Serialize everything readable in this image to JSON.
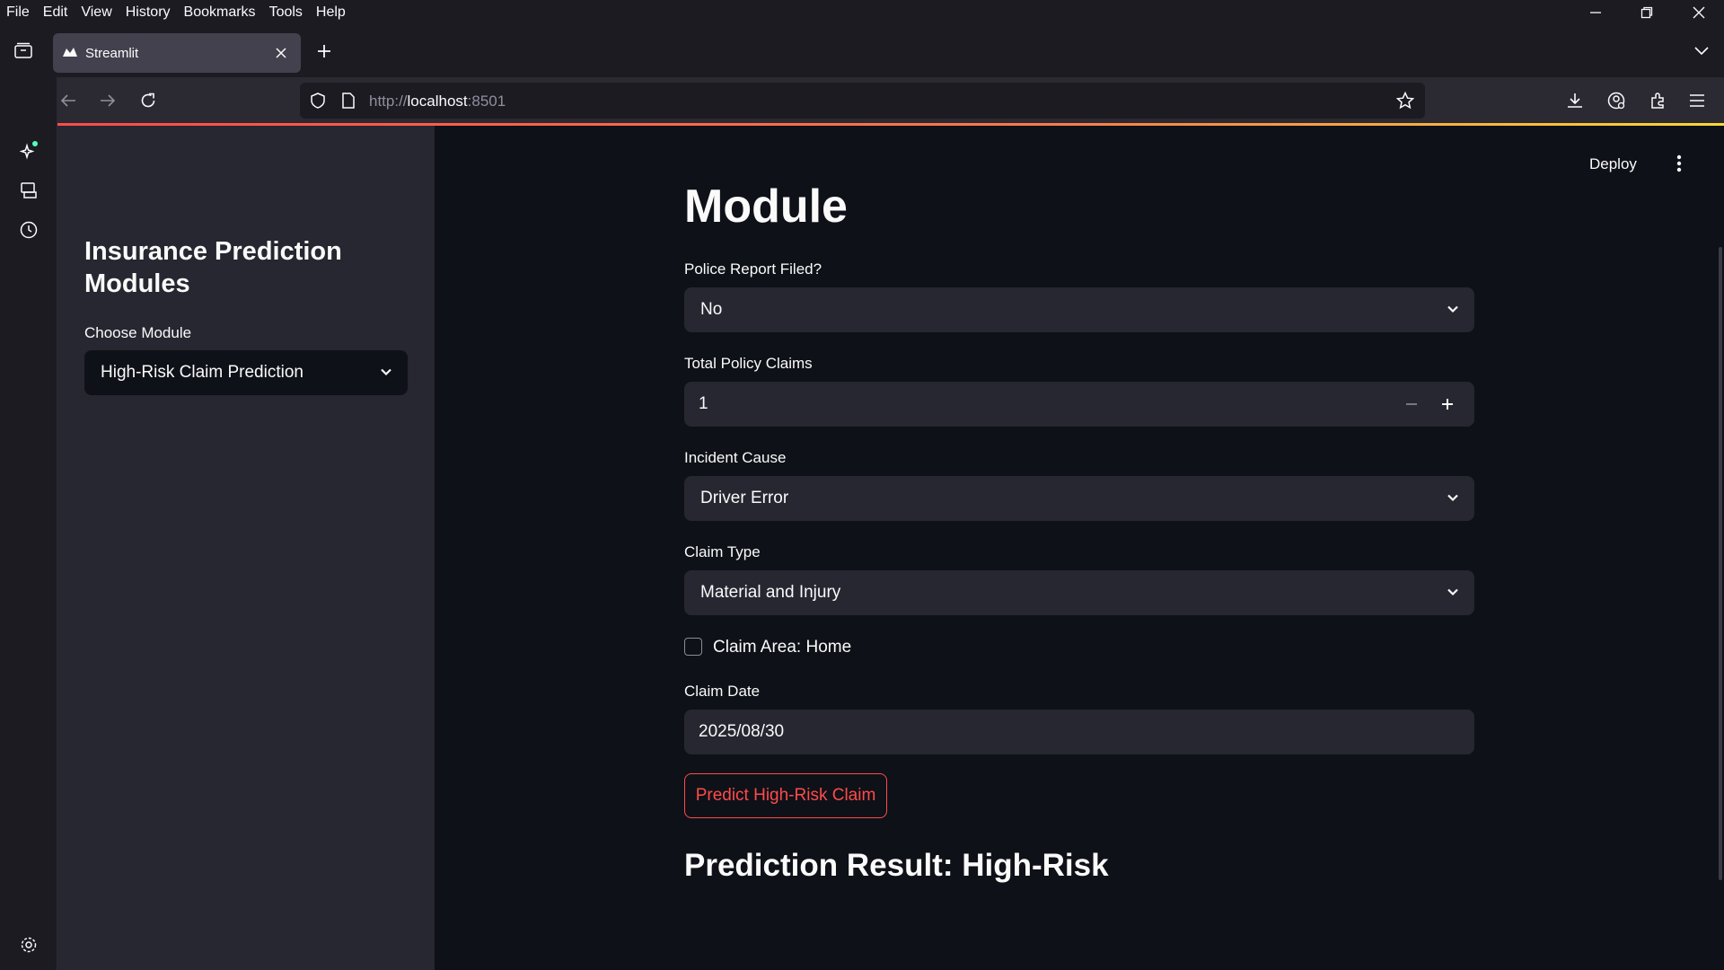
{
  "menu": [
    "File",
    "Edit",
    "View",
    "History",
    "Bookmarks",
    "Tools",
    "Help"
  ],
  "tab": {
    "title": "Streamlit"
  },
  "url": {
    "prefix": "http://",
    "host": "localhost",
    "port": ":8501"
  },
  "sidebar": {
    "title": "Insurance Prediction Modules",
    "choose_label": "Choose Module",
    "selected_module": "High-Risk Claim Prediction"
  },
  "header": {
    "deploy_label": "Deploy"
  },
  "main": {
    "title": "Module",
    "police_label": "Police Report Filed?",
    "police_value": "No",
    "claims_label": "Total Policy Claims",
    "claims_value": "1",
    "cause_label": "Incident Cause",
    "cause_value": "Driver Error",
    "type_label": "Claim Type",
    "type_value": "Material and Injury",
    "area_label": "Claim Area: Home",
    "area_checked": false,
    "date_label": "Claim Date",
    "date_value": "2025/08/30",
    "predict_button": "Predict High-Risk Claim",
    "result": "Prediction Result: High-Risk"
  },
  "colors": {
    "accent": "#ff4b4b",
    "bg": "#0e1117",
    "sidebar": "#262730",
    "field": "#262730",
    "browser_chrome": "#1c1b22"
  }
}
